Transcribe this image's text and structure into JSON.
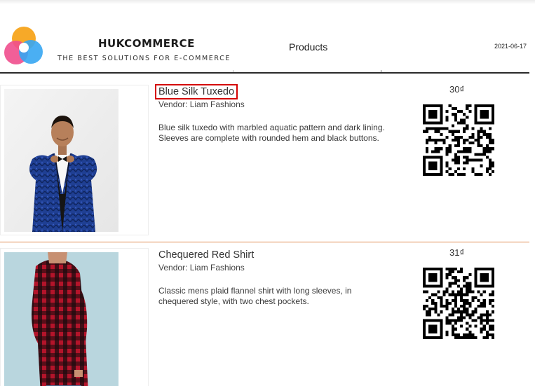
{
  "header": {
    "brand_name": "HUKCOMMERCE",
    "tagline": "THE BEST SOLUTIONS FOR E-COMMERCE",
    "page_title": "Products",
    "date": "2021-06-17"
  },
  "products": [
    {
      "name": "Blue Silk Tuxedo",
      "vendor": "Vendor: Liam Fashions",
      "description": "Blue silk tuxedo with marbled aquatic pattern and dark lining. Sleeves are complete with rounded hem and black buttons.",
      "price": "30₫",
      "selected": true
    },
    {
      "name": "Chequered Red Shirt",
      "vendor": "Vendor: Liam Fashions",
      "description": "Classic mens plaid flannel shirt with long sleeves, in chequered style, with two chest pockets.",
      "price": "31₫",
      "selected": false
    }
  ],
  "colors": {
    "selection_outline": "#d40000",
    "row_divider": "#e0894f",
    "header_rule": "#2a2a2a"
  }
}
